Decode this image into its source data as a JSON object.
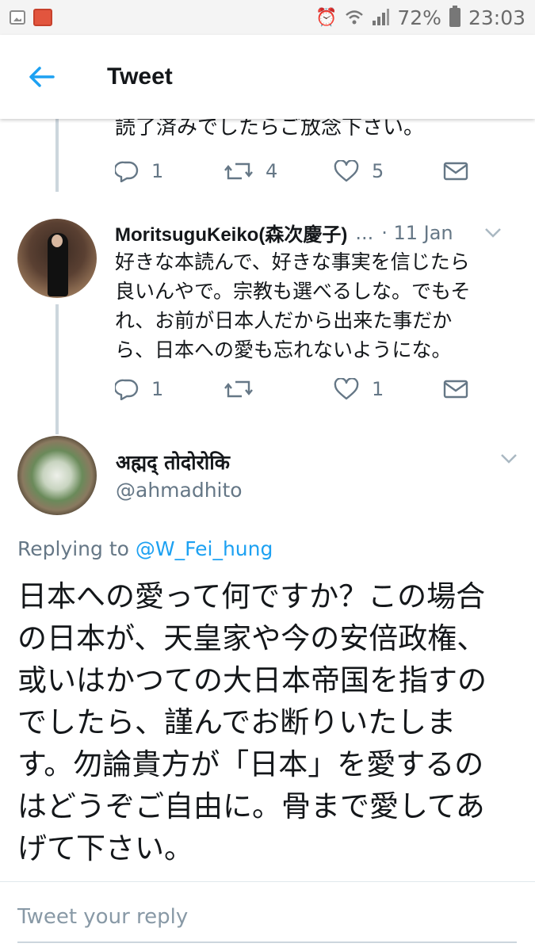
{
  "status_bar": {
    "battery": "72%",
    "time": "23:03",
    "left_icons": [
      "gallery-icon",
      "camera-icon"
    ],
    "right_icons": [
      "alarm-icon",
      "wifi-icon",
      "signal-icon",
      "battery-icon"
    ]
  },
  "app_bar": {
    "title": "Tweet",
    "back_icon": "back-arrow-icon"
  },
  "thread": {
    "previous_tweet": {
      "text_tail": "読了済みでしたらご放念下さい。",
      "actions": {
        "replies": "1",
        "retweets": "4",
        "likes": "5"
      }
    },
    "reply": {
      "name": "MoritsuguKeiko(森次慶子)",
      "ellipsis": "...",
      "date": "· 11 Jan",
      "lines": [
        "好きな本読んで、好きな事実を信じたら",
        "良いんやで。宗教も選べるしな。でもそ",
        "れ、お前が日本人だから出来た事だか",
        "ら、日本への愛も忘れないようにな。"
      ],
      "actions": {
        "replies": "1",
        "retweets": "",
        "likes": "1"
      }
    },
    "main_tweet": {
      "name": "अह्मद् तोदोरोकि",
      "handle": "@ahmadhito",
      "replying_prefix": "Replying to",
      "replying_to": "@W_Fei_hung",
      "lines": [
        "日本への愛って何ですか？この場合",
        "の日本が、天皇家や今の安倍政権、",
        "或いはかつての大日本帝国を指すの",
        "でしたら、謹んでお断りいたしま",
        "す。勿論貴方が「日本」を愛するの",
        "はどうぞご自由に。骨まで愛してあ",
        "げて下さい。"
      ]
    }
  },
  "compose": {
    "placeholder": "Tweet your reply"
  },
  "colors": {
    "accent": "#1da1f2",
    "muted": "#657786",
    "thread_line": "#ccd6dd"
  }
}
